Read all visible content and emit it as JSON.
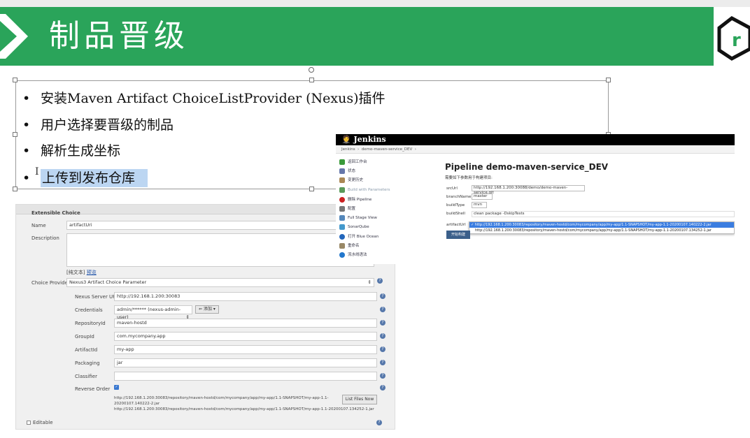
{
  "slide": {
    "title": "制品晋级",
    "bullets": [
      "安装Maven Artifact ChoiceListProvider (Nexus)插件",
      "用户选择要晋级的制品",
      "解析生成坐标",
      "上传到发布仓库"
    ],
    "bullet_char": "•",
    "cursor_glyph": "I",
    "logo_letter": "r",
    "colors": {
      "banner": "#2aa45a",
      "highlight": "#bcd6f2"
    }
  },
  "plugin_config": {
    "section_title": "Extensible Choice",
    "name_label": "Name",
    "name_value": "artifactUri",
    "description_label": "Description",
    "escape_html": "[纯文本]",
    "preview_link": "预览",
    "choice_provider_label": "Choice Provider",
    "choice_provider_value": "Nexus3 Artifact Choice Parameter",
    "nexus_url_label": "Nexus Server URL",
    "nexus_url_value": "http://192.168.1.200:30083",
    "credentials_label": "Credentials",
    "credentials_value": "admin/****** (nexus-admin-user)",
    "add_button": "添加",
    "repository_label": "RepositoryId",
    "repository_value": "maven-hostd",
    "groupid_label": "GroupId",
    "groupid_value": "com.mycompany.app",
    "artifactid_label": "ArtifactId",
    "artifactid_value": "my-app",
    "packaging_label": "Packaging",
    "packaging_value": "jar",
    "classifier_label": "Classifier",
    "classifier_value": "",
    "reverse_label": "Reverse Order",
    "reverse_checked": true,
    "result1": "http://192.168.1.200:30083/repository/maven-hostd/com/mycompany/app/my-app/1.1-SNAPSHOT/my-app-1.1-",
    "result1b": "20200107.140222-2.jar",
    "result2": "http://192.168.1.200:30083/repository/maven-hostd/com/mycompany/app/my-app/1.1-SNAPSHOT/my-app-1.1-20200107.134252-1.jar",
    "list_files_button": "List Files Now",
    "editable_label": "Editable"
  },
  "jenkins": {
    "logo": "Jenkins",
    "breadcrumb_root": "Jenkins",
    "breadcrumb_job": "demo-maven-service_DEV",
    "sidebar": [
      "返回工作台",
      "状态",
      "变更历史",
      "Build with Parameters",
      "删除 Pipeline",
      "配置",
      "Full Stage View",
      "SonarQube",
      "打开 Blue Ocean",
      "重命名",
      "流水线语法"
    ],
    "page_title": "Pipeline demo-maven-service_DEV",
    "subtitle": "需要如下参数用于构建项目:",
    "params": [
      {
        "label": "srcUrl",
        "value": "http://192.168.1.200:30088/demo/demo-maven-service.git"
      },
      {
        "label": "branchName",
        "value": "master"
      },
      {
        "label": "buildType",
        "value": "mvn"
      },
      {
        "label": "buildShell",
        "value": "clean package -DskipTests"
      },
      {
        "label": "artifactUrl",
        "value": ""
      }
    ],
    "artifact_options": [
      "http://192.168.1.200:30083/repository/maven-hostd/com/mycompany/app/my-app/1.1-SNAPSHOT/my-app-1.1-20200107.140222-2.jar",
      "http://192.168.1.200:30083/repository/maven-hostd/com/mycompany/app/my-app/1.1-SNAPSHOT/my-app-1.1-20200107.134252-1.jar"
    ],
    "selected_mark": "✓",
    "build_button": "开始构建"
  }
}
